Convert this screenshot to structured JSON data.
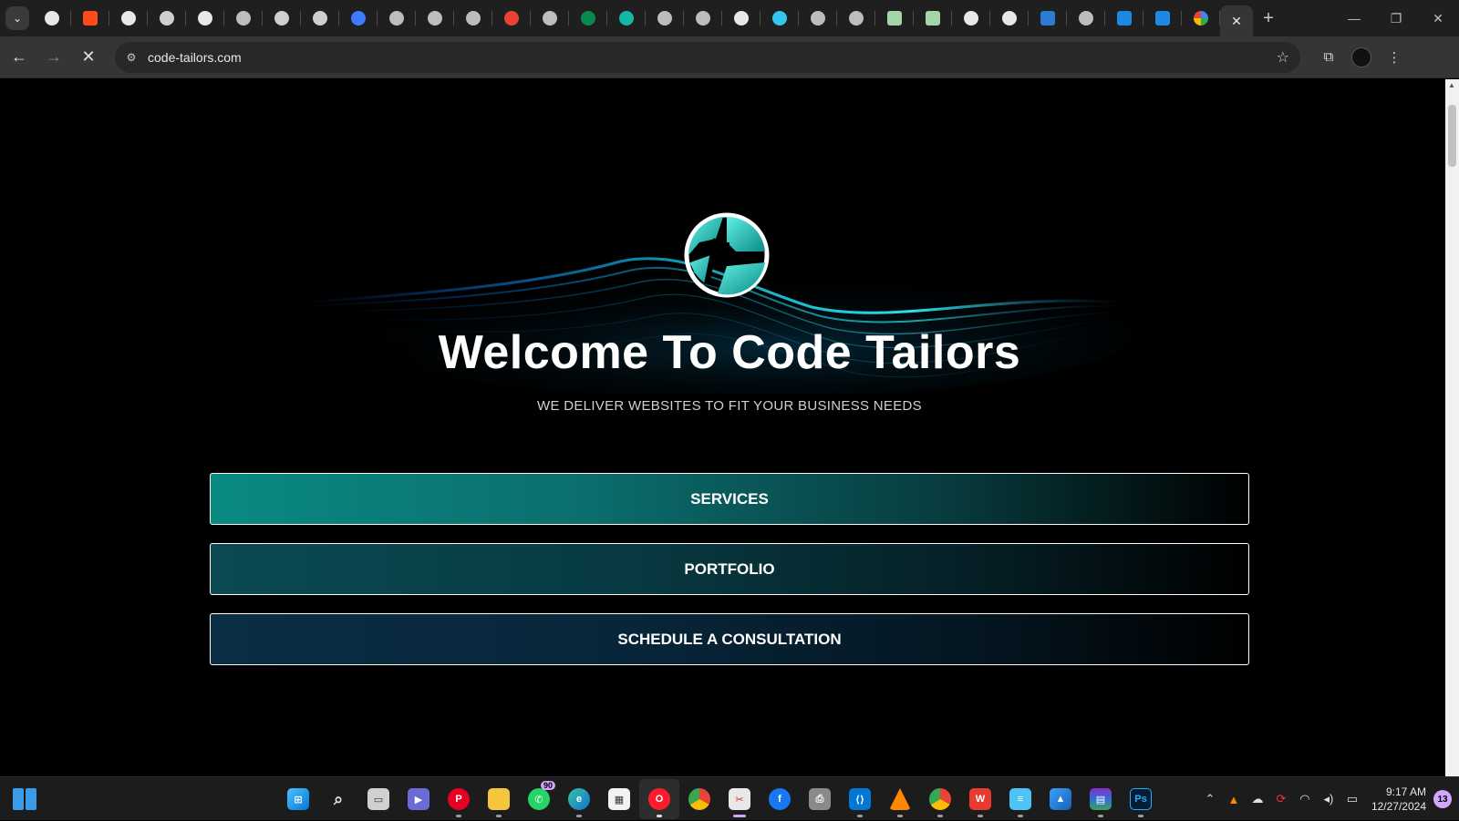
{
  "browser": {
    "url": "code-tailors.com",
    "tab_favicons": [
      "chrome-icon",
      "mailchimp-icon",
      "github-icon",
      "openai-icon",
      "github-icon",
      "web-icon",
      "openai-icon",
      "openai-icon",
      "circle-icon",
      "web-icon",
      "web-icon",
      "web-icon",
      "gmail-icon",
      "web-icon",
      "leaf-icon",
      "diamond-icon",
      "web-icon",
      "web-icon",
      "github-icon",
      "slack-icon",
      "web-icon",
      "web-icon",
      "image-icon",
      "image-icon",
      "chrome-icon",
      "chrome-icon",
      "ms-icon",
      "web-icon",
      "doc-icon",
      "doc-icon",
      "google-icon"
    ],
    "active_tab_close": "✕",
    "new_tab": "+"
  },
  "page": {
    "title": "Welcome To Code Tailors",
    "subtitle": "WE DELIVER WEBSITES TO FIT YOUR BUSINESS NEEDS",
    "buttons": {
      "services": "SERVICES",
      "portfolio": "PORTFOLIO",
      "consultation": "SCHEDULE A CONSULTATION"
    },
    "colors": {
      "accent": "#0a8a83",
      "accent_light": "#3fd8d0",
      "background": "#000000"
    }
  },
  "taskbar": {
    "whatsapp_badge": "90",
    "clock_time": "9:17 AM",
    "clock_date": "12/27/2024",
    "notification_count": "13"
  }
}
